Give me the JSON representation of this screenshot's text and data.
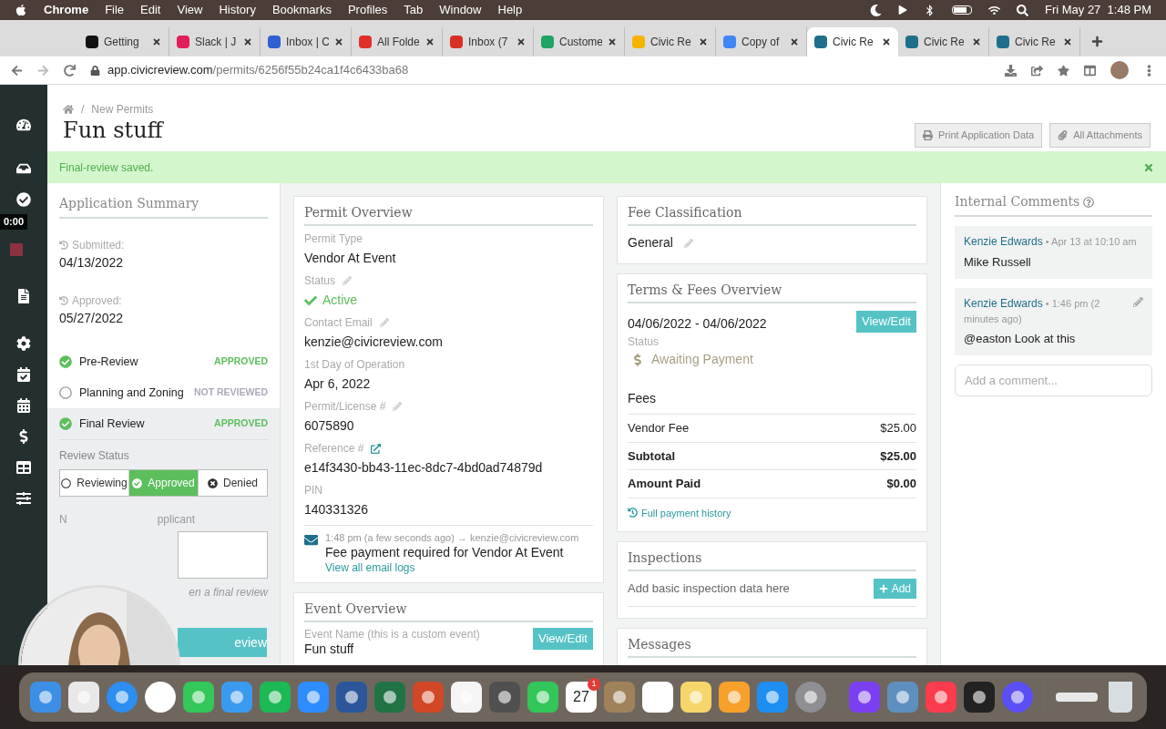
{
  "menu_bar": {
    "app": "Chrome",
    "items": [
      "File",
      "Edit",
      "View",
      "History",
      "Bookmarks",
      "Profiles",
      "Tab",
      "Window",
      "Help"
    ],
    "clock": "Fri May 27  1:48 PM"
  },
  "browser_tabs": [
    {
      "title": "Getting",
      "selected": false,
      "color": "#111111"
    },
    {
      "title": "Slack | J",
      "selected": false,
      "color": "#e01e5a"
    },
    {
      "title": "Inbox | C",
      "selected": false,
      "color": "#2f5fd0"
    },
    {
      "title": "All Folde",
      "selected": false,
      "color": "#e0302a"
    },
    {
      "title": "Inbox (7",
      "selected": false,
      "color": "#d93025"
    },
    {
      "title": "Custome",
      "selected": false,
      "color": "#1fa463"
    },
    {
      "title": "Civic Re",
      "selected": false,
      "color": "#f4b400"
    },
    {
      "title": "Copy of",
      "selected": false,
      "color": "#4285f4"
    },
    {
      "title": "Civic Re",
      "selected": true,
      "color": "#1f6f8b"
    },
    {
      "title": "Civic Re",
      "selected": false,
      "color": "#1f6f8b"
    },
    {
      "title": "Civic Re",
      "selected": false,
      "color": "#1f6f8b"
    }
  ],
  "address": {
    "host": "app.civicreview.com",
    "path": "/permits/6256f55b24ca1f4c6433ba68"
  },
  "recorder_time": "0:00",
  "breadcrumb": {
    "separator": "/",
    "label": "New Permits"
  },
  "page_title": "Fun stuff",
  "header_buttons": [
    "Print Application Data",
    "All Attachments"
  ],
  "alert": "Final-review saved.",
  "summary": {
    "title": "Application Summary",
    "dates": [
      {
        "label": "Submitted:",
        "value": "04/13/2022"
      },
      {
        "label": "Approved:",
        "value": "05/27/2022"
      }
    ],
    "reviews": [
      {
        "name": "Pre-Review",
        "status": "APPROVED",
        "done": true,
        "selected": false
      },
      {
        "name": "Planning and Zoning",
        "status": "NOT REVIEWED",
        "done": false,
        "selected": false
      },
      {
        "name": "Final Review",
        "status": "APPROVED",
        "done": true,
        "selected": true
      }
    ],
    "review_status_label": "Review Status",
    "review_options": [
      {
        "label": "Reviewing",
        "kind": "circle",
        "selected": false
      },
      {
        "label": "Approved",
        "kind": "check",
        "selected": true
      },
      {
        "label": "Denied",
        "kind": "cross",
        "selected": false
      }
    ],
    "note_label_start": "N",
    "note_label_end": "pplicant",
    "note_hint": "en a final review",
    "save_button": "eview"
  },
  "permit_overview": {
    "title": "Permit Overview",
    "fields": [
      {
        "label": "Permit Type",
        "value": "Vendor At Event",
        "kind": "text",
        "editable": false
      },
      {
        "label": "Status",
        "value": "Active",
        "kind": "status",
        "editable": true
      },
      {
        "label": "Contact Email",
        "value": "kenzie@civicreview.com",
        "kind": "text",
        "editable": true
      },
      {
        "label": "1st Day of Operation",
        "value": "Apr 6, 2022",
        "kind": "text",
        "editable": false
      },
      {
        "label": "Permit/License #",
        "value": "6075890",
        "kind": "text",
        "editable": true
      },
      {
        "label": "Reference #",
        "value": "e14f3430-bb43-11ec-8dc7-4bd0ad74879d",
        "kind": "link",
        "editable": false
      },
      {
        "label": "PIN",
        "value": "140331326",
        "kind": "text",
        "editable": false
      }
    ],
    "email_log": {
      "time": "1:48 pm (a few seconds ago)",
      "arrow": "→",
      "to": "kenzie@civicreview.com",
      "subject": "Fee payment required for Vendor At Event",
      "link": "View all email logs"
    }
  },
  "event_overview": {
    "title": "Event Overview",
    "label": "Event Name (this is a custom event)",
    "value": "Fun stuff",
    "button": "View/Edit"
  },
  "fee_classification": {
    "title": "Fee Classification",
    "value": "General"
  },
  "terms": {
    "title": "Terms & Fees Overview",
    "dates": "04/06/2022 - 04/06/2022",
    "button": "View/Edit",
    "status_label": "Status",
    "status": "Awaiting Payment",
    "fees_title": "Fees",
    "fees": [
      {
        "label": "Vendor Fee",
        "amount": "$25.00",
        "bold": false
      },
      {
        "label": "Subtotal",
        "amount": "$25.00",
        "bold": true
      },
      {
        "label": "Amount Paid",
        "amount": "$0.00",
        "bold": true
      }
    ],
    "history_link": "Full payment history"
  },
  "inspections": {
    "title": "Inspections",
    "text": "Add basic inspection data here",
    "button": "Add"
  },
  "messages": {
    "title": "Messages"
  },
  "comments": {
    "title": "Internal Comments",
    "items": [
      {
        "author": "Kenzie Edwards",
        "time": "• Apr 13 at 10:10 am",
        "text": "Mike Russell",
        "editable": false
      },
      {
        "author": "Kenzie Edwards",
        "time": "• 1:46 pm (2 minutes ago)",
        "text": "@easton Look at this",
        "editable": true
      }
    ],
    "placeholder": "Add a comment..."
  },
  "webcam": {
    "kind": "picture"
  },
  "dock": [
    {
      "kind": "finder",
      "color": "#3d8fe6"
    },
    {
      "kind": "launchpad",
      "color": "#e8e8e8"
    },
    {
      "kind": "safari",
      "color": "#2b8ef0"
    },
    {
      "kind": "chrome",
      "color": "#ffffff"
    },
    {
      "kind": "messages",
      "color": "#34c759"
    },
    {
      "kind": "mail",
      "color": "#3a9af0"
    },
    {
      "kind": "spotify",
      "color": "#1db954"
    },
    {
      "kind": "zoom",
      "color": "#2d8cff"
    },
    {
      "kind": "word",
      "color": "#2b579a"
    },
    {
      "kind": "excel",
      "color": "#217346"
    },
    {
      "kind": "powerpoint",
      "color": "#d24726"
    },
    {
      "kind": "photos",
      "color": "#f5f5f5"
    },
    {
      "kind": "calculator",
      "color": "#505050"
    },
    {
      "kind": "facetime",
      "color": "#33c759"
    },
    {
      "kind": "calendar",
      "color": "#ffffff",
      "day": "27",
      "badge": "1"
    },
    {
      "kind": "contacts",
      "color": "#a0825a"
    },
    {
      "kind": "reminders",
      "color": "#ffffff"
    },
    {
      "kind": "notes",
      "color": "#f6d66b"
    },
    {
      "kind": "pages",
      "color": "#f7a02c"
    },
    {
      "kind": "appstore",
      "color": "#1e8ef2"
    },
    {
      "kind": "settings",
      "color": "#8e8e93"
    },
    {
      "kind": "separator",
      "color": "#6b6b6b"
    },
    {
      "kind": "messenger",
      "color": "#7b3ff2"
    },
    {
      "kind": "preview",
      "color": "#5f8fbf"
    },
    {
      "kind": "music",
      "color": "#fa3c4c"
    },
    {
      "kind": "creative",
      "color": "#222222"
    },
    {
      "kind": "flower",
      "color": "#5a4ff5"
    },
    {
      "kind": "separator",
      "color": "#6b6b6b"
    },
    {
      "kind": "minimized",
      "color": "#e8e8e8"
    },
    {
      "kind": "trash",
      "color": "#d8dde2"
    }
  ]
}
